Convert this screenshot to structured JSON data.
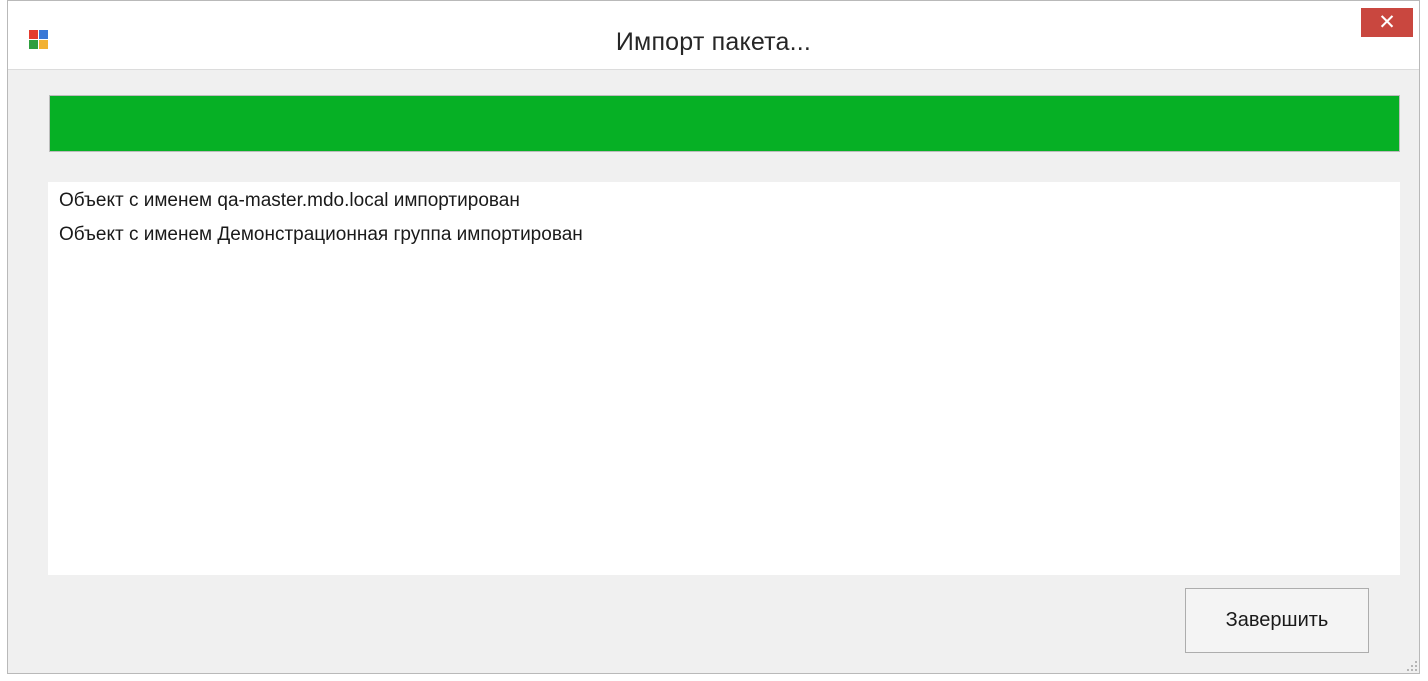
{
  "window": {
    "title": "Импорт пакета...",
    "close_label": "✕"
  },
  "progress": {
    "value_percent": 100,
    "color": "#06b025"
  },
  "log": {
    "entries": [
      "Объект с именем qa-master.mdo.local импортирован",
      "Объект с именем Демонстрационная группа импортирован"
    ]
  },
  "buttons": {
    "finish_label": "Завершить"
  },
  "icons": {
    "app": "app-window-icon",
    "close": "close-icon",
    "resize_grip": "resize-grip-icon"
  }
}
